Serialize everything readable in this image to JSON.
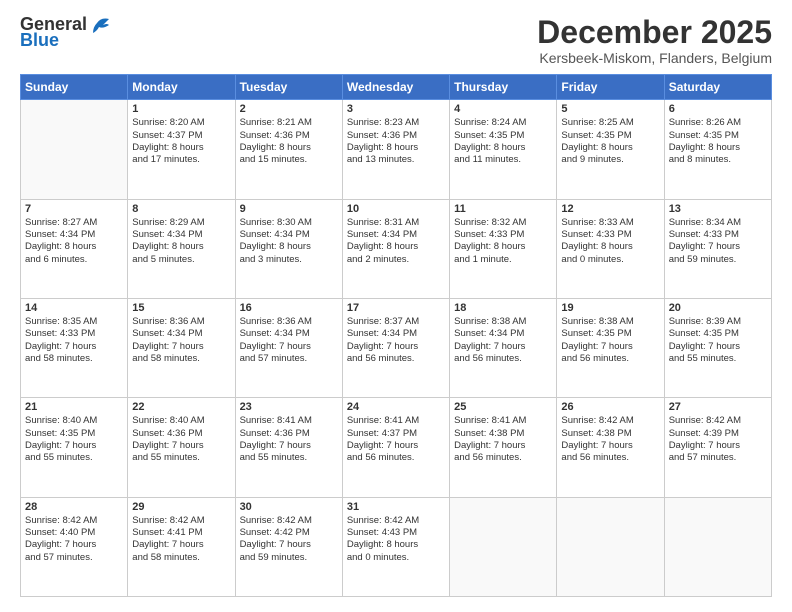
{
  "logo": {
    "general": "General",
    "blue": "Blue"
  },
  "title": "December 2025",
  "subtitle": "Kersbeek-Miskom, Flanders, Belgium",
  "header_days": [
    "Sunday",
    "Monday",
    "Tuesday",
    "Wednesday",
    "Thursday",
    "Friday",
    "Saturday"
  ],
  "weeks": [
    [
      {
        "day": "",
        "info": ""
      },
      {
        "day": "1",
        "info": "Sunrise: 8:20 AM\nSunset: 4:37 PM\nDaylight: 8 hours\nand 17 minutes."
      },
      {
        "day": "2",
        "info": "Sunrise: 8:21 AM\nSunset: 4:36 PM\nDaylight: 8 hours\nand 15 minutes."
      },
      {
        "day": "3",
        "info": "Sunrise: 8:23 AM\nSunset: 4:36 PM\nDaylight: 8 hours\nand 13 minutes."
      },
      {
        "day": "4",
        "info": "Sunrise: 8:24 AM\nSunset: 4:35 PM\nDaylight: 8 hours\nand 11 minutes."
      },
      {
        "day": "5",
        "info": "Sunrise: 8:25 AM\nSunset: 4:35 PM\nDaylight: 8 hours\nand 9 minutes."
      },
      {
        "day": "6",
        "info": "Sunrise: 8:26 AM\nSunset: 4:35 PM\nDaylight: 8 hours\nand 8 minutes."
      }
    ],
    [
      {
        "day": "7",
        "info": "Sunrise: 8:27 AM\nSunset: 4:34 PM\nDaylight: 8 hours\nand 6 minutes."
      },
      {
        "day": "8",
        "info": "Sunrise: 8:29 AM\nSunset: 4:34 PM\nDaylight: 8 hours\nand 5 minutes."
      },
      {
        "day": "9",
        "info": "Sunrise: 8:30 AM\nSunset: 4:34 PM\nDaylight: 8 hours\nand 3 minutes."
      },
      {
        "day": "10",
        "info": "Sunrise: 8:31 AM\nSunset: 4:34 PM\nDaylight: 8 hours\nand 2 minutes."
      },
      {
        "day": "11",
        "info": "Sunrise: 8:32 AM\nSunset: 4:33 PM\nDaylight: 8 hours\nand 1 minute."
      },
      {
        "day": "12",
        "info": "Sunrise: 8:33 AM\nSunset: 4:33 PM\nDaylight: 8 hours\nand 0 minutes."
      },
      {
        "day": "13",
        "info": "Sunrise: 8:34 AM\nSunset: 4:33 PM\nDaylight: 7 hours\nand 59 minutes."
      }
    ],
    [
      {
        "day": "14",
        "info": "Sunrise: 8:35 AM\nSunset: 4:33 PM\nDaylight: 7 hours\nand 58 minutes."
      },
      {
        "day": "15",
        "info": "Sunrise: 8:36 AM\nSunset: 4:34 PM\nDaylight: 7 hours\nand 58 minutes."
      },
      {
        "day": "16",
        "info": "Sunrise: 8:36 AM\nSunset: 4:34 PM\nDaylight: 7 hours\nand 57 minutes."
      },
      {
        "day": "17",
        "info": "Sunrise: 8:37 AM\nSunset: 4:34 PM\nDaylight: 7 hours\nand 56 minutes."
      },
      {
        "day": "18",
        "info": "Sunrise: 8:38 AM\nSunset: 4:34 PM\nDaylight: 7 hours\nand 56 minutes."
      },
      {
        "day": "19",
        "info": "Sunrise: 8:38 AM\nSunset: 4:35 PM\nDaylight: 7 hours\nand 56 minutes."
      },
      {
        "day": "20",
        "info": "Sunrise: 8:39 AM\nSunset: 4:35 PM\nDaylight: 7 hours\nand 55 minutes."
      }
    ],
    [
      {
        "day": "21",
        "info": "Sunrise: 8:40 AM\nSunset: 4:35 PM\nDaylight: 7 hours\nand 55 minutes."
      },
      {
        "day": "22",
        "info": "Sunrise: 8:40 AM\nSunset: 4:36 PM\nDaylight: 7 hours\nand 55 minutes."
      },
      {
        "day": "23",
        "info": "Sunrise: 8:41 AM\nSunset: 4:36 PM\nDaylight: 7 hours\nand 55 minutes."
      },
      {
        "day": "24",
        "info": "Sunrise: 8:41 AM\nSunset: 4:37 PM\nDaylight: 7 hours\nand 56 minutes."
      },
      {
        "day": "25",
        "info": "Sunrise: 8:41 AM\nSunset: 4:38 PM\nDaylight: 7 hours\nand 56 minutes."
      },
      {
        "day": "26",
        "info": "Sunrise: 8:42 AM\nSunset: 4:38 PM\nDaylight: 7 hours\nand 56 minutes."
      },
      {
        "day": "27",
        "info": "Sunrise: 8:42 AM\nSunset: 4:39 PM\nDaylight: 7 hours\nand 57 minutes."
      }
    ],
    [
      {
        "day": "28",
        "info": "Sunrise: 8:42 AM\nSunset: 4:40 PM\nDaylight: 7 hours\nand 57 minutes."
      },
      {
        "day": "29",
        "info": "Sunrise: 8:42 AM\nSunset: 4:41 PM\nDaylight: 7 hours\nand 58 minutes."
      },
      {
        "day": "30",
        "info": "Sunrise: 8:42 AM\nSunset: 4:42 PM\nDaylight: 7 hours\nand 59 minutes."
      },
      {
        "day": "31",
        "info": "Sunrise: 8:42 AM\nSunset: 4:43 PM\nDaylight: 8 hours\nand 0 minutes."
      },
      {
        "day": "",
        "info": ""
      },
      {
        "day": "",
        "info": ""
      },
      {
        "day": "",
        "info": ""
      }
    ]
  ]
}
